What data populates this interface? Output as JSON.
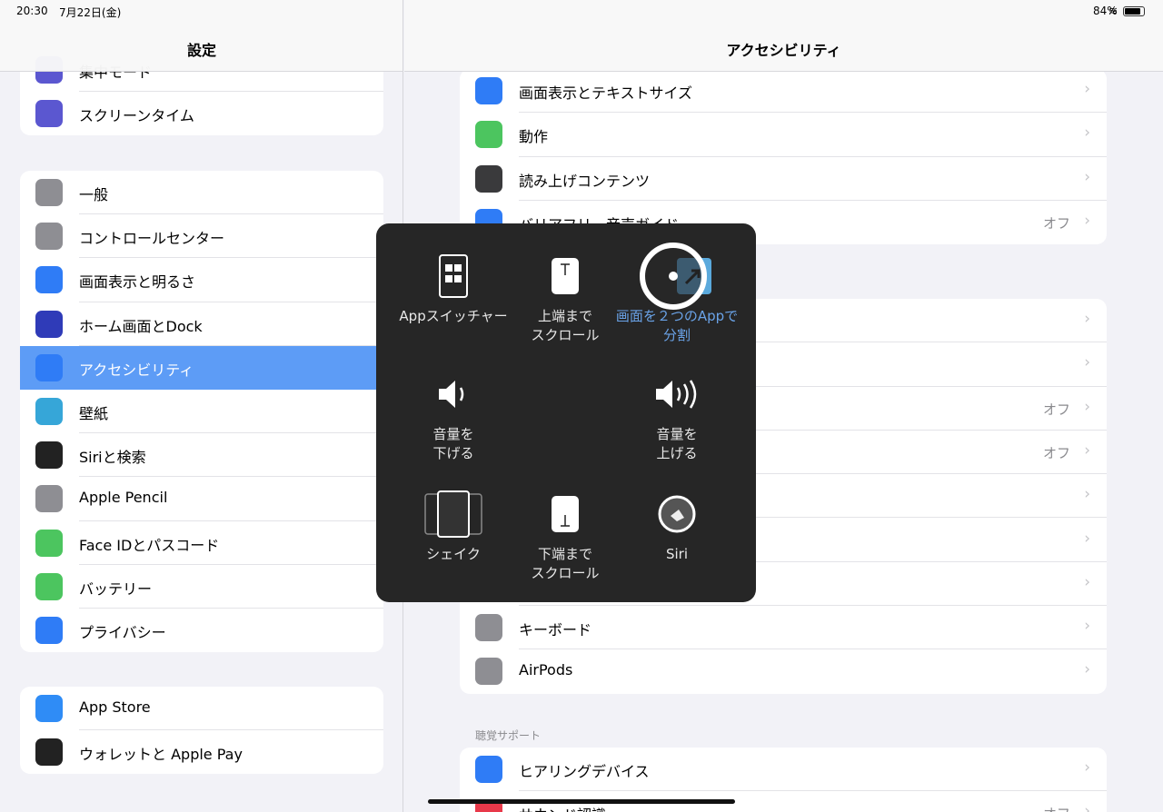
{
  "status": {
    "time": "20:30",
    "date": "7月22日(金)",
    "battery": "84%"
  },
  "left": {
    "title": "設定",
    "groups": [
      {
        "items": [
          {
            "label": "集中モード",
            "icon": "moon-icon",
            "color": "#5b57d0"
          },
          {
            "label": "スクリーンタイム",
            "icon": "hourglass-icon",
            "color": "#5b57d0"
          }
        ]
      },
      {
        "items": [
          {
            "label": "一般",
            "icon": "gear-icon",
            "color": "#8e8e93"
          },
          {
            "label": "コントロールセンター",
            "icon": "toggle-icon",
            "color": "#8e8e93"
          },
          {
            "label": "画面表示と明るさ",
            "icon": "text-size-icon",
            "color": "#2f7cf6"
          },
          {
            "label": "ホーム画面とDock",
            "icon": "grid-icon",
            "color": "#2f3bb8"
          },
          {
            "label": "アクセシビリティ",
            "icon": "accessibility-icon",
            "color": "#2f7cf6",
            "selected": true
          },
          {
            "label": "壁紙",
            "icon": "flower-icon",
            "color": "#36a6d8"
          },
          {
            "label": "Siriと検索",
            "icon": "siri-icon",
            "color": "#222"
          },
          {
            "label": "Apple Pencil",
            "icon": "pencil-icon",
            "color": "#8e8e93"
          },
          {
            "label": "Face IDとパスコード",
            "icon": "face-id-icon",
            "color": "#4cc55f"
          },
          {
            "label": "バッテリー",
            "icon": "battery-icon",
            "color": "#4cc55f"
          },
          {
            "label": "プライバシー",
            "icon": "hand-icon",
            "color": "#2f7cf6"
          }
        ]
      },
      {
        "items": [
          {
            "label": "App Store",
            "icon": "app-store-icon",
            "color": "#2f8cf6"
          },
          {
            "label": "ウォレットと Apple Pay",
            "icon": "wallet-icon",
            "color": "#222"
          }
        ]
      }
    ]
  },
  "right": {
    "title": "アクセシビリティ",
    "groups": [
      {
        "items": [
          {
            "label": "画面表示とテキストサイズ",
            "icon": "text-size-icon",
            "color": "#2f7cf6"
          },
          {
            "label": "動作",
            "icon": "motion-icon",
            "color": "#4cc55f"
          },
          {
            "label": "読み上げコンテンツ",
            "icon": "speech-icon",
            "color": "#3a3a3c"
          },
          {
            "label": "バリアフリー音声ガイド",
            "icon": "audio-description-icon",
            "color": "#2f7cf6",
            "value": "オフ"
          }
        ]
      },
      {
        "items": [
          {
            "label": ""
          },
          {
            "label": ""
          },
          {
            "label": "",
            "value": "オフ"
          },
          {
            "label": "",
            "value": "オフ"
          },
          {
            "label": ""
          },
          {
            "label": ""
          },
          {
            "label": ""
          },
          {
            "label": "キーボード",
            "icon": "keyboard-icon",
            "color": "#8e8e93"
          },
          {
            "label": "AirPods",
            "icon": "airpods-icon",
            "color": "#8e8e93"
          }
        ]
      },
      {
        "header": "聴覚サポート",
        "items": [
          {
            "label": "ヒアリングデバイス",
            "icon": "ear-icon",
            "color": "#2f7cf6"
          },
          {
            "label": "サウンド認識",
            "icon": "sound-recognition-icon",
            "color": "#e8394a",
            "value": "オフ"
          }
        ]
      }
    ]
  },
  "menu": {
    "items": [
      {
        "label": "Appスイッチャー",
        "icon": "app-switcher-icon"
      },
      {
        "label": "上端まで\nスクロール",
        "icon": "scroll-to-top-icon"
      },
      {
        "label": "画面を２つのAppで\n分割",
        "icon": "split-screen-icon",
        "active": true
      },
      {
        "label": "音量を\n下げる",
        "icon": "volume-down-icon"
      },
      {
        "label": "音量を\n上げる",
        "icon": "volume-up-icon"
      },
      {
        "label": "シェイク",
        "icon": "shake-icon"
      },
      {
        "label": "下端まで\nスクロール",
        "icon": "scroll-to-bottom-icon"
      },
      {
        "label": "Siri",
        "icon": "siri-icon"
      }
    ]
  }
}
